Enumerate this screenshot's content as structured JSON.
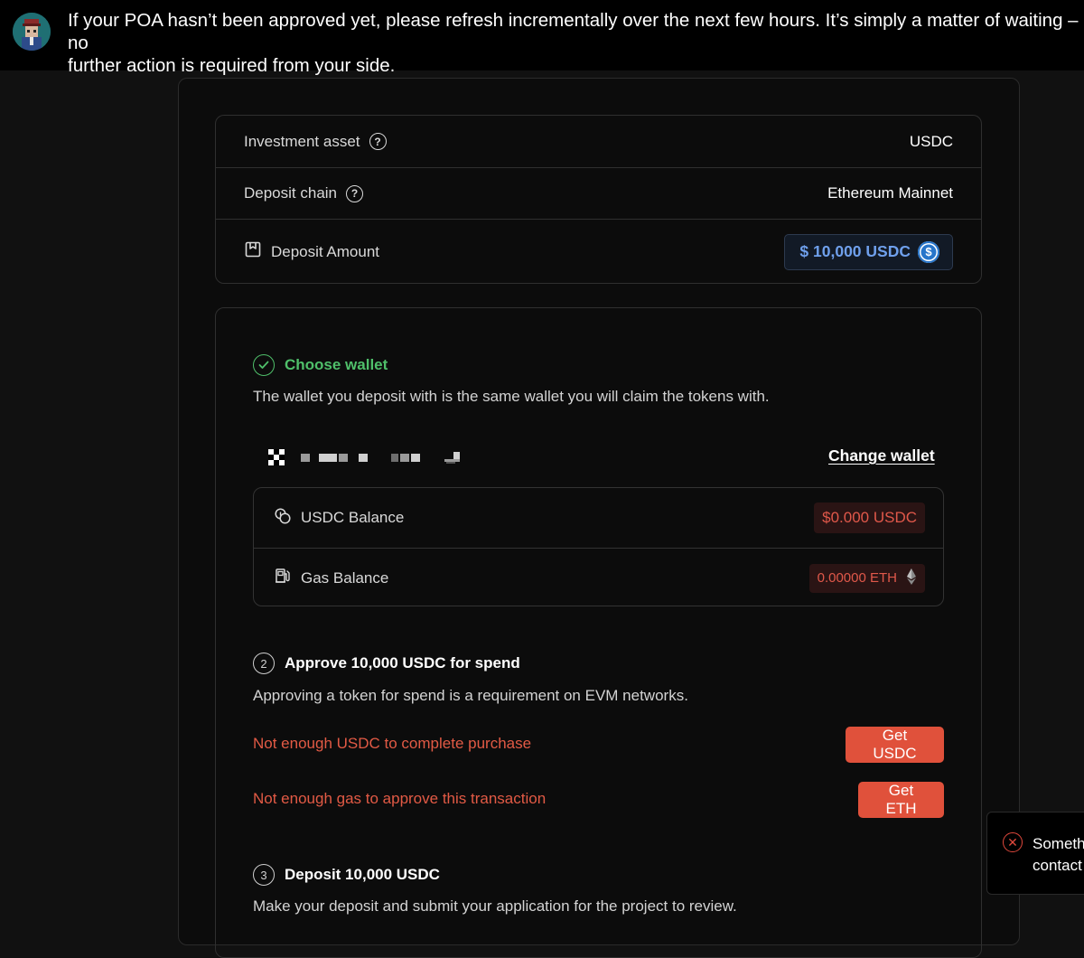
{
  "banner": {
    "message": "If your POA hasn’t been approved yet, please refresh incrementally over the next few hours. It’s simply a matter of waiting – no\nfurther action is required from your side."
  },
  "summary": {
    "asset_label": "Investment asset",
    "asset_value": "USDC",
    "chain_label": "Deposit chain",
    "chain_value": "Ethereum Mainnet",
    "amount_label": "Deposit Amount",
    "amount_value": "$ 10,000 USDC"
  },
  "step1": {
    "title": "Choose wallet",
    "description": "The wallet you deposit with is the same wallet you will claim the tokens with.",
    "change_wallet": "Change wallet"
  },
  "balances": {
    "usdc_label": "USDC Balance",
    "usdc_value": "$0.000 USDC",
    "gas_label": "Gas Balance",
    "gas_value": "0.00000 ETH"
  },
  "step2": {
    "number": "2",
    "title": "Approve 10,000 USDC for spend",
    "description": "Approving a token for spend is a requirement on EVM networks.",
    "error_usdc": "Not enough USDC to complete purchase",
    "get_usdc": "Get USDC",
    "error_gas": "Not enough gas to approve this transaction",
    "get_eth": "Get ETH"
  },
  "step3": {
    "number": "3",
    "title": "Deposit 10,000 USDC",
    "description": "Make your deposit and submit your application for the project to review."
  },
  "toast": {
    "message": "Someth\ncontact"
  },
  "colors": {
    "accent_blue": "#6fa0ec",
    "success_green": "#4fbf6a",
    "error_red": "#e0513b",
    "usdc_blue": "#2775ca"
  },
  "icons": {
    "help": "question-circle-icon",
    "amount": "bookmark-box-icon",
    "done": "check-circle-icon",
    "usdc_balance": "coins-icon",
    "gas_balance": "fuel-pump-icon",
    "eth": "ethereum-icon",
    "toast": "x-circle-icon"
  }
}
